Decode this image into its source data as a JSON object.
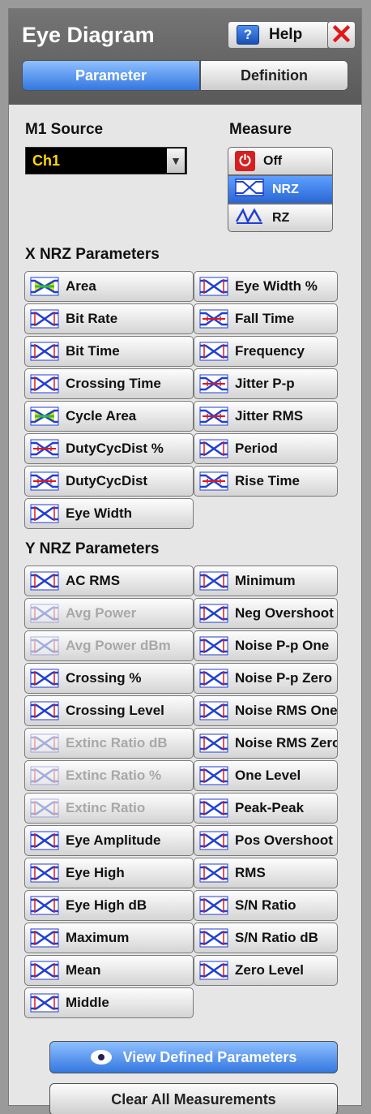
{
  "header": {
    "title": "Eye Diagram",
    "help_label": "Help",
    "help_icon": "?",
    "close_icon": "✕"
  },
  "tabs": {
    "active": "Parameter",
    "inactive": "Definition"
  },
  "source": {
    "label": "M1 Source",
    "value": "Ch1",
    "arrow": "▼"
  },
  "measure": {
    "label": "Measure",
    "options": [
      {
        "label": "Off",
        "icon": "power-icon",
        "selected": false
      },
      {
        "label": "NRZ",
        "icon": "nrz-icon",
        "selected": true
      },
      {
        "label": "RZ",
        "icon": "rz-icon",
        "selected": false
      }
    ]
  },
  "x_params": {
    "title": "X NRZ Parameters",
    "items": [
      {
        "label": "Area",
        "icon": "area-icon",
        "enabled": true
      },
      {
        "label": "Eye Width %",
        "icon": "eye-width-percent-icon",
        "enabled": true
      },
      {
        "label": "Bit Rate",
        "icon": "bit-rate-icon",
        "enabled": true
      },
      {
        "label": "Fall Time",
        "icon": "fall-time-icon",
        "enabled": true
      },
      {
        "label": "Bit Time",
        "icon": "bit-time-icon",
        "enabled": true
      },
      {
        "label": "Frequency",
        "icon": "frequency-icon",
        "enabled": true
      },
      {
        "label": "Crossing Time",
        "icon": "crossing-time-icon",
        "enabled": true
      },
      {
        "label": "Jitter P-p",
        "icon": "jitter-pp-icon",
        "enabled": true
      },
      {
        "label": "Cycle Area",
        "icon": "cycle-area-icon",
        "enabled": true
      },
      {
        "label": "Jitter RMS",
        "icon": "jitter-rms-icon",
        "enabled": true
      },
      {
        "label": "DutyCycDist %",
        "icon": "duty-cyc-dist-percent-icon",
        "enabled": true
      },
      {
        "label": "Period",
        "icon": "period-icon",
        "enabled": true
      },
      {
        "label": "DutyCycDist",
        "icon": "duty-cyc-dist-icon",
        "enabled": true
      },
      {
        "label": "Rise Time",
        "icon": "rise-time-icon",
        "enabled": true
      },
      {
        "label": "Eye Width",
        "icon": "eye-width-icon",
        "enabled": true
      }
    ]
  },
  "y_params": {
    "title": "Y NRZ Parameters",
    "items": [
      {
        "label": "AC RMS",
        "icon": "ac-rms-icon",
        "enabled": true
      },
      {
        "label": "Minimum",
        "icon": "minimum-icon",
        "enabled": true
      },
      {
        "label": "Avg Power",
        "icon": "avg-power-icon",
        "enabled": false
      },
      {
        "label": "Neg Overshoot",
        "icon": "neg-overshoot-icon",
        "enabled": true
      },
      {
        "label": "Avg Power dBm",
        "icon": "avg-power-dbm-icon",
        "enabled": false
      },
      {
        "label": "Noise P-p One",
        "icon": "noise-pp-one-icon",
        "enabled": true
      },
      {
        "label": "Crossing %",
        "icon": "crossing-percent-icon",
        "enabled": true
      },
      {
        "label": "Noise P-p Zero",
        "icon": "noise-pp-zero-icon",
        "enabled": true
      },
      {
        "label": "Crossing Level",
        "icon": "crossing-level-icon",
        "enabled": true
      },
      {
        "label": "Noise RMS One",
        "icon": "noise-rms-one-icon",
        "enabled": true
      },
      {
        "label": "Extinc Ratio dB",
        "icon": "extinc-ratio-db-icon",
        "enabled": false
      },
      {
        "label": "Noise RMS Zero",
        "icon": "noise-rms-zero-icon",
        "enabled": true
      },
      {
        "label": "Extinc Ratio %",
        "icon": "extinc-ratio-percent-icon",
        "enabled": false
      },
      {
        "label": "One Level",
        "icon": "one-level-icon",
        "enabled": true
      },
      {
        "label": "Extinc Ratio",
        "icon": "extinc-ratio-icon",
        "enabled": false
      },
      {
        "label": "Peak-Peak",
        "icon": "peak-peak-icon",
        "enabled": true
      },
      {
        "label": "Eye Amplitude",
        "icon": "eye-amplitude-icon",
        "enabled": true
      },
      {
        "label": "Pos Overshoot",
        "icon": "pos-overshoot-icon",
        "enabled": true
      },
      {
        "label": "Eye High",
        "icon": "eye-high-icon",
        "enabled": true
      },
      {
        "label": "RMS",
        "icon": "rms-icon",
        "enabled": true
      },
      {
        "label": "Eye High dB",
        "icon": "eye-high-db-icon",
        "enabled": true
      },
      {
        "label": "S/N Ratio",
        "icon": "sn-ratio-icon",
        "enabled": true
      },
      {
        "label": "Maximum",
        "icon": "maximum-icon",
        "enabled": true
      },
      {
        "label": "S/N Ratio dB",
        "icon": "sn-ratio-db-icon",
        "enabled": true
      },
      {
        "label": "Mean",
        "icon": "mean-icon",
        "enabled": true
      },
      {
        "label": "Zero Level",
        "icon": "zero-level-icon",
        "enabled": true
      },
      {
        "label": "Middle",
        "icon": "middle-icon",
        "enabled": true
      }
    ]
  },
  "footer": {
    "view_label": "View Defined Parameters",
    "view_icon": "eye-icon",
    "clear_label": "Clear All Measurements"
  },
  "colors": {
    "accent_blue": "#3377e0",
    "icon_blue": "#1f3fd6",
    "icon_red": "#e01818",
    "source_text": "#ffd700"
  }
}
